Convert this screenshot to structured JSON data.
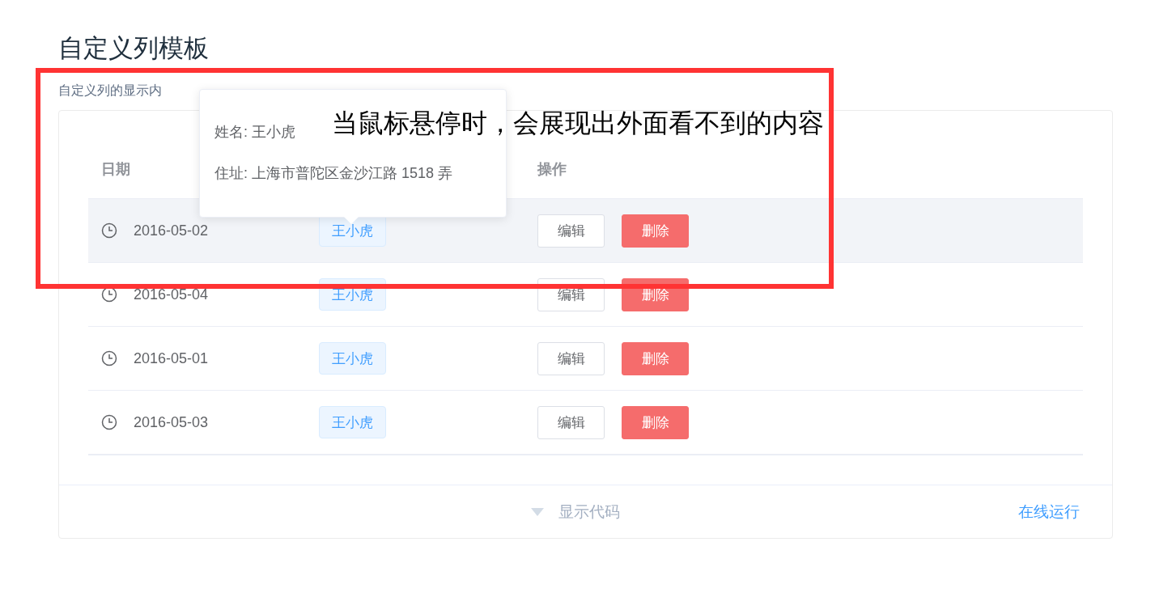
{
  "page": {
    "title": "自定义列模板",
    "description": "自定义列的显示内"
  },
  "table": {
    "columns": [
      {
        "label": "日期"
      },
      {
        "label": "操作"
      }
    ],
    "rows": [
      {
        "date": "2016-05-02",
        "name": "王小虎",
        "edit": "编辑",
        "delete": "删除",
        "hovered": true
      },
      {
        "date": "2016-05-04",
        "name": "王小虎",
        "edit": "编辑",
        "delete": "删除",
        "hovered": false
      },
      {
        "date": "2016-05-01",
        "name": "王小虎",
        "edit": "编辑",
        "delete": "删除",
        "hovered": false
      },
      {
        "date": "2016-05-03",
        "name": "王小虎",
        "edit": "编辑",
        "delete": "删除",
        "hovered": false
      }
    ]
  },
  "tooltip": {
    "lines": [
      "姓名: 王小虎",
      "住址: 上海市普陀区金沙江路 1518 弄"
    ]
  },
  "footer": {
    "toggle": "显示代码",
    "run": "在线运行"
  },
  "annotation": {
    "text": "当鼠标悬停时，会展现出外面看不到的内容"
  }
}
